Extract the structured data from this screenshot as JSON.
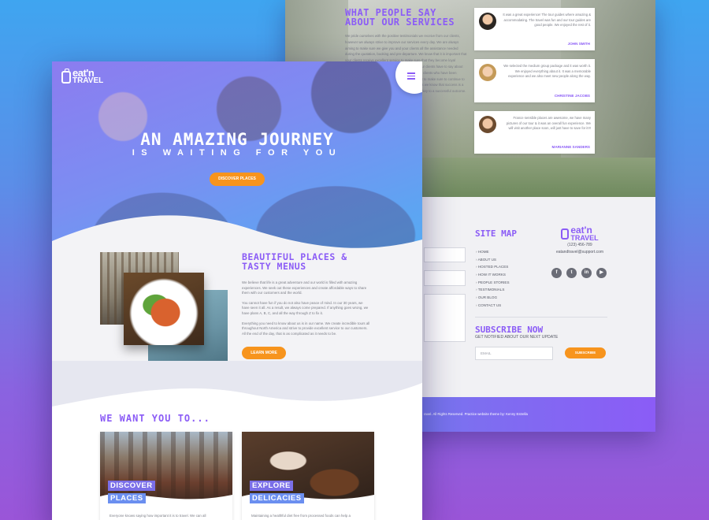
{
  "colors": {
    "accent_purple": "#8b5cf6",
    "accent_orange": "#f7941d",
    "background_gradient_start": "#3fa5f0",
    "background_gradient_end": "#9a55d8"
  },
  "back_page": {
    "testimonials_section": {
      "title_line1": "WHAT PEOPLE SAY",
      "title_line2": "ABOUT OUR SERVICES",
      "paragraph": "We pride ourselves with the positive testimonials we receive from our clients, however we always strive to improve our services every day. We are always aiming to make sure we give you and your clients all the assistance needed during the quotation, booking and pre-departure. We know that it is important that your clients receive excellent service to make sure that they become loyal returning clients in the future. Read what some of our clients have to say about our services and our tour programs. We have many clients who have been sending us their clients for many years and we want to make sure to continue to do so. We value both our clients and our partners as we know that success is a team effort and good communication between us is key to a successful outcome. Thank you!"
    },
    "testimonials": [
      {
        "quote": "It was a great experience! The tour guides where amazing & accommodating. The travel was fun and our tour guides are good people. We enjoyed the rest of it.",
        "author": "JOHN SMITH",
        "avatar_icon": "avatar-man-icon"
      },
      {
        "quote": "We selected the medium group package and it was worth it. We enjoyed everything about it. It was a memorable experience and we also meet new people along the way.",
        "author": "CHRISTINE JACOBS",
        "avatar_icon": "avatar-woman-icon"
      },
      {
        "quote": "France sensible places are awesome, we have many pictures of our tour & it was an overall fun experience. We will visit another place soon, will just have to save for it!!!",
        "author": "MARIANNE SANDERS",
        "avatar_icon": "avatar-woman-icon"
      }
    ],
    "sitemap": {
      "title": "SITE MAP",
      "items": [
        "HOME",
        "ABOUT US",
        "HOSTED PLACES",
        "HOW IT WORKS",
        "PEOPLE STORIES",
        "TESTIMONIALS",
        "OUR BLOG",
        "CONTACT US"
      ]
    },
    "brand": {
      "logo_text_top": "eat'n",
      "logo_text_bottom": "TRAVEL",
      "phone": "(123) 456-789",
      "email": "eatandtravel@support.com",
      "social_icons": [
        "facebook-icon",
        "twitter-icon",
        "linkedin-icon",
        "youtube-icon"
      ],
      "social_glyphs": [
        "f",
        "t",
        "in",
        "▶"
      ]
    },
    "subscribe": {
      "title": "SUBSCRIBE NOW",
      "subtitle": "GET NOTIFIED ABOUT OUR NEXT UPDATE",
      "email_placeholder": "EMAIL",
      "button_label": "SUBSCRIBE"
    },
    "copyright": "ravel. All Rights Reserved. Practice website theme by: Kenny Estrella"
  },
  "front_page": {
    "logo_text_top": "eat'n",
    "logo_text_bottom": "TRAVEL",
    "hero": {
      "title": "AN AMAZING JOURNEY",
      "subtitle": "IS WAITING FOR YOU",
      "cta_label": "DISCOVER PLACES"
    },
    "about": {
      "title_line1": "BEAUTIFUL PLACES &",
      "title_line2": "TASTY MENUS",
      "paragraphs": [
        "We believe that life is a great adventure and our world is filled with amazing experiences. We seek out these experiences and create affordable ways to share them with our customers and the world.",
        "You cannot have fun if you do not also have peace of mind. In our 30 years, we have seen it all. As a result, we always come prepared. If anything goes wrong, we have plans A, B, C, and all the way through Z to fix it.",
        "Everything you need to know about us is in our name. We create incredible tours all throughout North America and strive to provide excellent service to our customers. All the end of the day, that is as complicated as it needs to be."
      ],
      "button_label": "LEARN MORE"
    },
    "want_section": {
      "title": "WE WANT YOU TO...",
      "cards": [
        {
          "tag_line1": "DISCOVER",
          "tag_line2": "PLACES",
          "caption": "Everyone knows saying how important it is to travel. We can all"
        },
        {
          "tag_line1": "EXPLORE",
          "tag_line2": "DELICACIES",
          "caption": "Maintaining a healthful diet free from processed foods can help a"
        }
      ]
    }
  }
}
